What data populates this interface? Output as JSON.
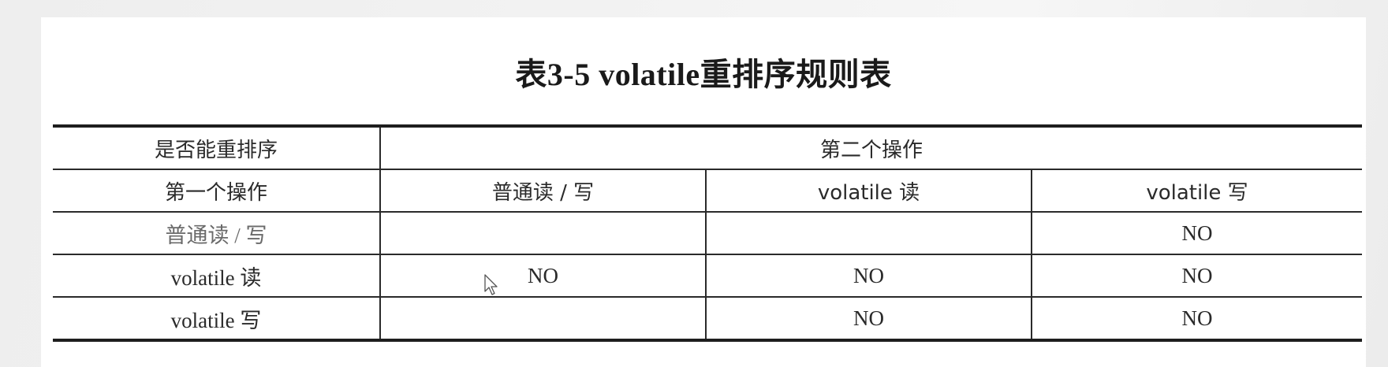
{
  "table": {
    "title": "表3-5   volatile重排序规则表",
    "corner_label": "是否能重排序",
    "second_op_label": "第二个操作",
    "first_op_label": "第一个操作",
    "columns": [
      "普通读 / 写",
      "volatile 读",
      "volatile 写"
    ],
    "rows": [
      {
        "label": "普通读 / 写",
        "cells": [
          "",
          "",
          "NO"
        ]
      },
      {
        "label": "volatile 读",
        "cells": [
          "NO",
          "NO",
          "NO"
        ]
      },
      {
        "label": "volatile 写",
        "cells": [
          "",
          "NO",
          "NO"
        ]
      }
    ]
  },
  "icons": {
    "cursor": "mouse-pointer-icon"
  }
}
